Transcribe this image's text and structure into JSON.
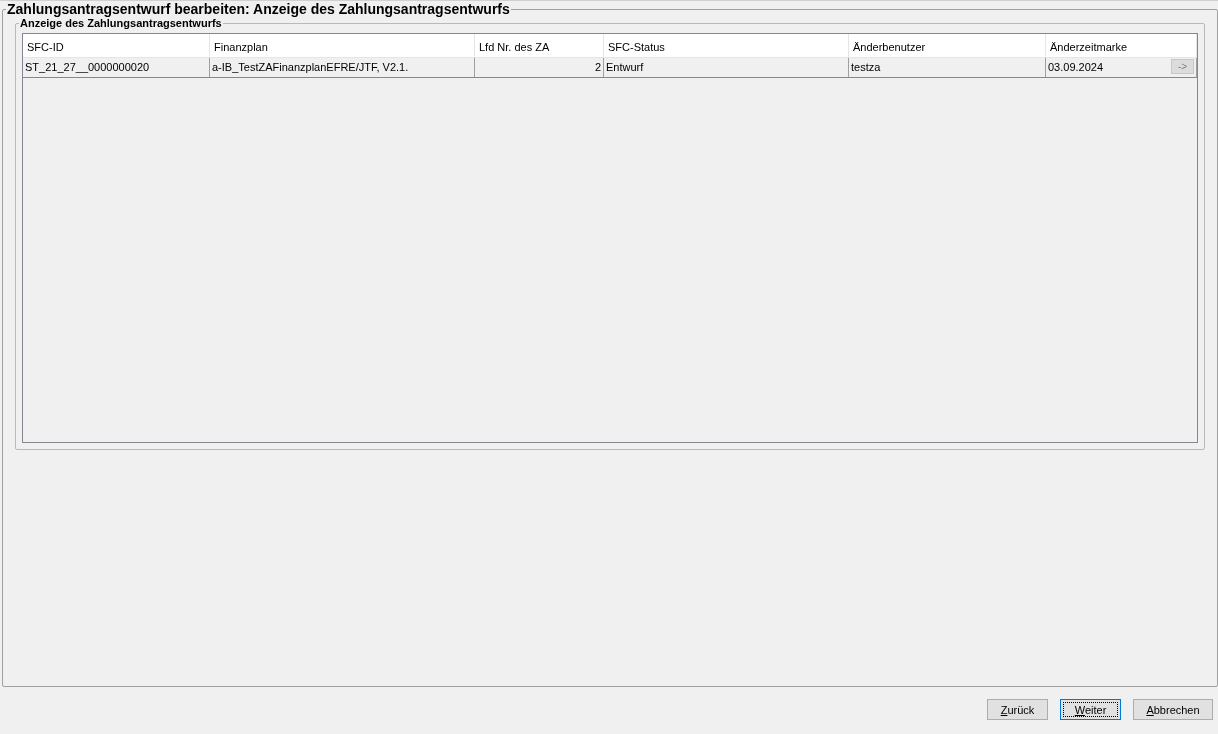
{
  "window": {
    "title": "Zahlungsantragsentwurf bearbeiten: Anzeige des Zahlungsantragsentwurfs"
  },
  "panel": {
    "title": "Anzeige des Zahlungsantragsentwurfs"
  },
  "table": {
    "columns": [
      {
        "label": "SFC-ID",
        "kind": "text"
      },
      {
        "label": "Finanzplan",
        "kind": "text"
      },
      {
        "label": "Lfd Nr. des ZA",
        "kind": "number"
      },
      {
        "label": "SFC-Status",
        "kind": "text"
      },
      {
        "label": "Änderbenutzer",
        "kind": "text"
      },
      {
        "label": "Änderzeitmarke",
        "kind": "text"
      }
    ],
    "rows": [
      {
        "cells": [
          "ST_21_27__0000000020",
          "a-IB_TestZAFinanzplanEFRE/JTF, V2.1.",
          "2",
          "Entwurf",
          "testza",
          "03.09.2024"
        ],
        "action": "->",
        "action_disabled": true
      }
    ]
  },
  "buttons": [
    {
      "label": "Zurück",
      "focused": false
    },
    {
      "label": "Weiter",
      "focused": true
    },
    {
      "label": "Abbrechen",
      "focused": false
    }
  ]
}
